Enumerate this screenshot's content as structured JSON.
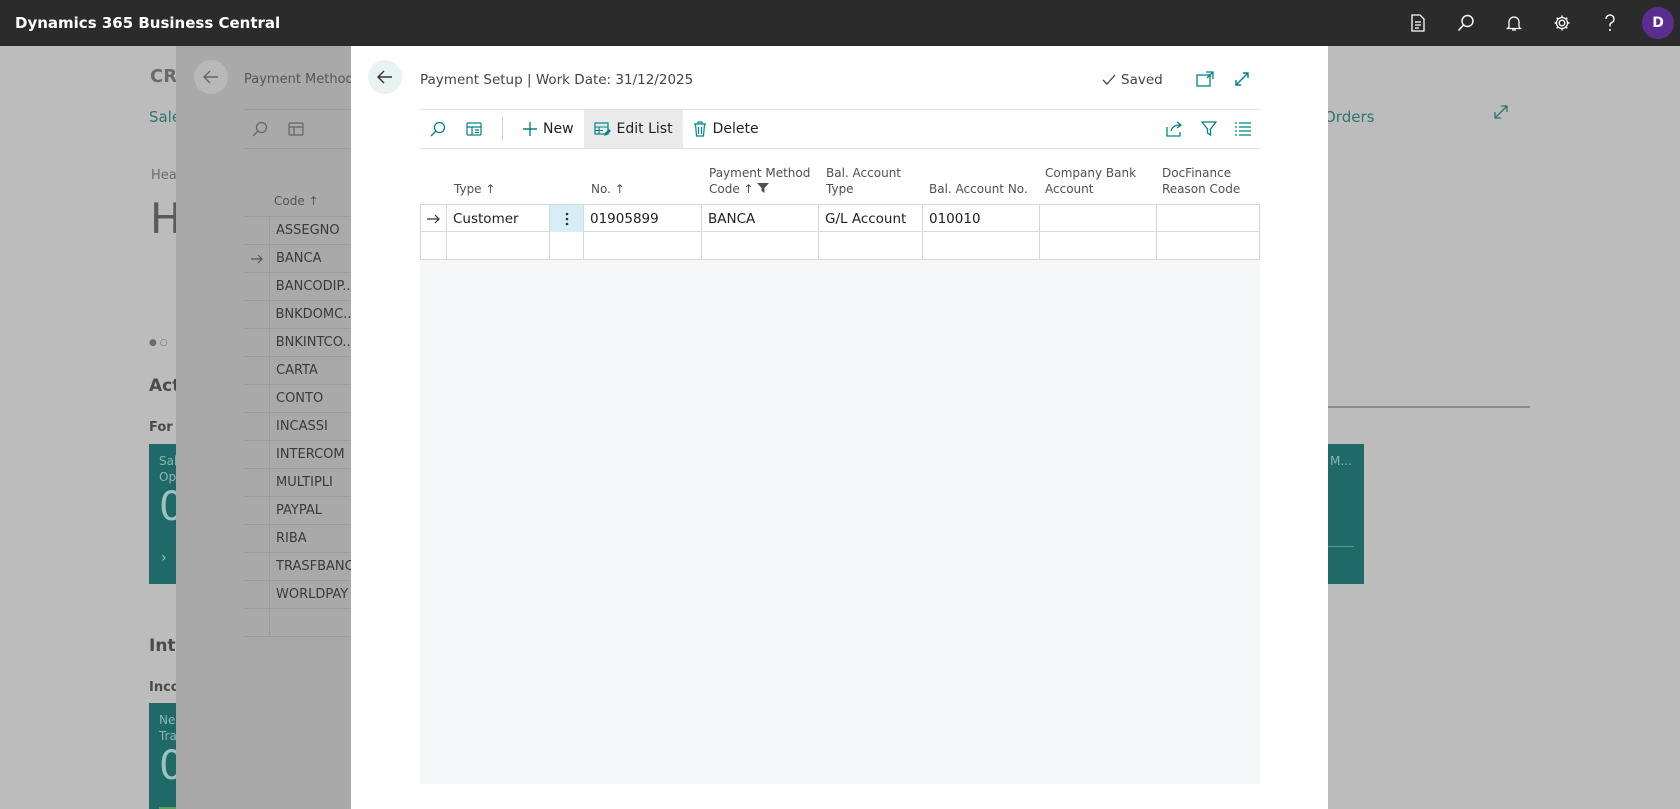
{
  "app": {
    "title": "Dynamics 365 Business Central",
    "avatar_letter": "D"
  },
  "topbar_icons": [
    "document-icon",
    "search-icon",
    "bell-icon",
    "gear-icon",
    "help-icon"
  ],
  "background": {
    "company": "CR",
    "nav_link": "Sale",
    "orders_link": "Orders",
    "headline_label": "Hea",
    "headline_glyph": "H",
    "activities": "Act",
    "for_label": "For I",
    "tile1_top": "Sal",
    "tile1_sub": "Op",
    "tile1_value": "0",
    "tile2_label": "M...",
    "intercompany": "Inte",
    "incoming": "Inco",
    "tile3_top": "Ne",
    "tile3_sub": "Tra",
    "tile3_value": "0"
  },
  "payment_methods": {
    "title": "Payment Method",
    "column": "Code ↑",
    "rows": [
      "ASSEGNO",
      "BANCA",
      "BANCODIP...",
      "BNKDOMC...",
      "BNKINTCO...",
      "CARTA",
      "CONTO",
      "INCASSI",
      "INTERCOM",
      "MULTIPLI",
      "PAYPAL",
      "RIBA",
      "TRASFBANC",
      "WORLDPAY",
      ""
    ],
    "selected": "BANCA"
  },
  "modal": {
    "title": "Payment Setup | Work Date: 31/12/2025",
    "saved": "Saved",
    "toolbar": {
      "new": "New",
      "edit_list": "Edit List",
      "delete": "Delete"
    },
    "columns": {
      "type": "Type ↑",
      "no": "No. ↑",
      "pm_line1": "Payment Method",
      "pm_line2": "Code ↑",
      "bat_line1": "Bal. Account",
      "bat_line2": "Type",
      "ban": "Bal. Account No.",
      "cba_line1": "Company Bank",
      "cba_line2": "Account",
      "dfr_line1": "DocFinance",
      "dfr_line2": "Reason Code"
    },
    "rows": [
      {
        "type": "Customer",
        "no": "01905899",
        "pm": "BANCA",
        "bat": "G/L Account",
        "ban": "010010",
        "cba": "",
        "dfr": ""
      },
      {
        "type": "",
        "no": "",
        "pm": "",
        "bat": "",
        "ban": "",
        "cba": "",
        "dfr": ""
      }
    ]
  },
  "colors": {
    "accent": "#008489",
    "topbar": "#2b2b2b",
    "avatar": "#5c2d91",
    "selection": "#d5eef5"
  }
}
